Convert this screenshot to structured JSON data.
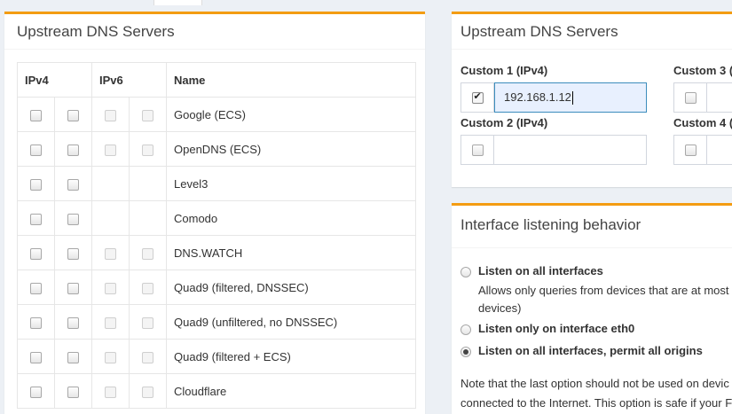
{
  "left_box": {
    "title": "Upstream DNS Servers",
    "col_ipv4": "IPv4",
    "col_ipv6": "IPv6",
    "col_name": "Name",
    "rows": [
      {
        "name": "Google (ECS)",
        "ipv6": true
      },
      {
        "name": "OpenDNS (ECS)",
        "ipv6": true
      },
      {
        "name": "Level3",
        "ipv6": false
      },
      {
        "name": "Comodo",
        "ipv6": false
      },
      {
        "name": "DNS.WATCH",
        "ipv6": true
      },
      {
        "name": "Quad9 (filtered, DNSSEC)",
        "ipv6": true
      },
      {
        "name": "Quad9 (unfiltered, no DNSSEC)",
        "ipv6": true
      },
      {
        "name": "Quad9 (filtered + ECS)",
        "ipv6": true
      },
      {
        "name": "Cloudflare",
        "ipv6": true
      }
    ]
  },
  "custom_box": {
    "title": "Upstream DNS Servers",
    "custom1_label": "Custom 1 (IPv4)",
    "custom1_value": "192.168.1.12",
    "custom1_checked": true,
    "custom2_label": "Custom 2 (IPv4)",
    "custom2_value": "",
    "custom3_label": "Custom 3 (",
    "custom4_label": "Custom 4 ("
  },
  "interface_box": {
    "title": "Interface listening behavior",
    "options": [
      {
        "label": "Listen on all interfaces",
        "desc_line1": "Allows only queries from devices that are at most",
        "desc_line2": "devices)"
      },
      {
        "label": "Listen only on interface eth0"
      },
      {
        "label": "Listen on all interfaces, permit all origins"
      }
    ],
    "selected_index": 2,
    "note_line1": "Note that the last option should not be used on devic",
    "note_line2": "connected to the Internet. This option is safe if your F"
  },
  "colors": {
    "accent": "#f39c12",
    "focus_border": "#3c8dbc",
    "focus_bg": "#e8f0fe"
  }
}
